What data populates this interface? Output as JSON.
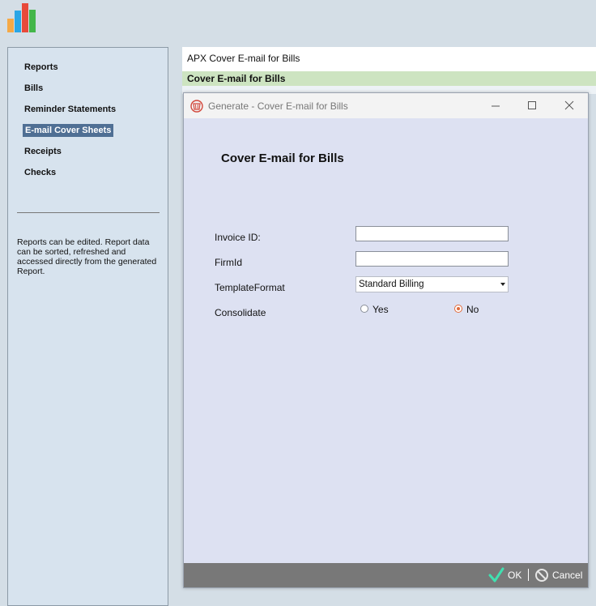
{
  "logo": {
    "icon": "bar-chart-logo",
    "colors": [
      "#f5a946",
      "#2aa6e6",
      "#e84a3b",
      "#43b649"
    ]
  },
  "sidebar": {
    "items": [
      {
        "label": "Reports",
        "selected": false
      },
      {
        "label": "Bills",
        "selected": false
      },
      {
        "label": "Reminder Statements",
        "selected": false
      },
      {
        "label": "E-mail Cover Sheets",
        "selected": true
      },
      {
        "label": "Receipts",
        "selected": false
      },
      {
        "label": "Checks",
        "selected": false
      }
    ],
    "description": "Reports can be edited. Report data can be sorted, refreshed and accessed directly from the generated Report."
  },
  "header": {
    "title": "APX Cover E-mail for Bills",
    "subtitle": "Cover E-mail for Bills"
  },
  "dialog": {
    "window_title": "Generate - Cover E-mail for Bills",
    "heading": "Cover E-mail for Bills",
    "fields": {
      "invoice_id": {
        "label": "Invoice ID:",
        "value": ""
      },
      "firm_id": {
        "label": "FirmId",
        "value": ""
      },
      "template_format": {
        "label": "TemplateFormat",
        "value": "Standard Billing"
      },
      "consolidate": {
        "label": "Consolidate",
        "options": [
          "Yes",
          "No"
        ],
        "selected": "No"
      }
    },
    "buttons": {
      "ok": "OK",
      "cancel": "Cancel"
    },
    "accent_color": "#e06a3b"
  }
}
